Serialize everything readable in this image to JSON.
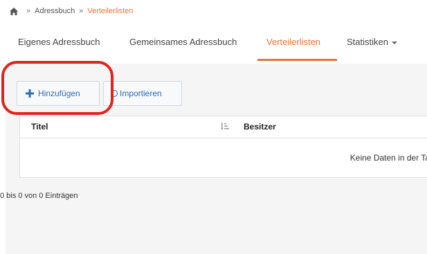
{
  "breadcrumb": {
    "items": [
      "Adressbuch",
      "Verteilerlisten"
    ],
    "separator": "»"
  },
  "tabs": [
    {
      "label": "Eigenes Adressbuch"
    },
    {
      "label": "Gemeinsames Adressbuch"
    },
    {
      "label": "Verteilerlisten",
      "active": true
    },
    {
      "label": "Statistiken"
    }
  ],
  "toolbar": {
    "add_label": "Hinzufügen",
    "import_label": "Importieren"
  },
  "table": {
    "columns": [
      "Titel",
      "Besitzer"
    ],
    "empty_text": "Keine Daten in der Ta"
  },
  "info_text": "0 bis 0 von 0 Einträgen",
  "colors": {
    "accent": "#e8743b",
    "link": "#2a6bb5",
    "highlight": "#e0241c"
  }
}
